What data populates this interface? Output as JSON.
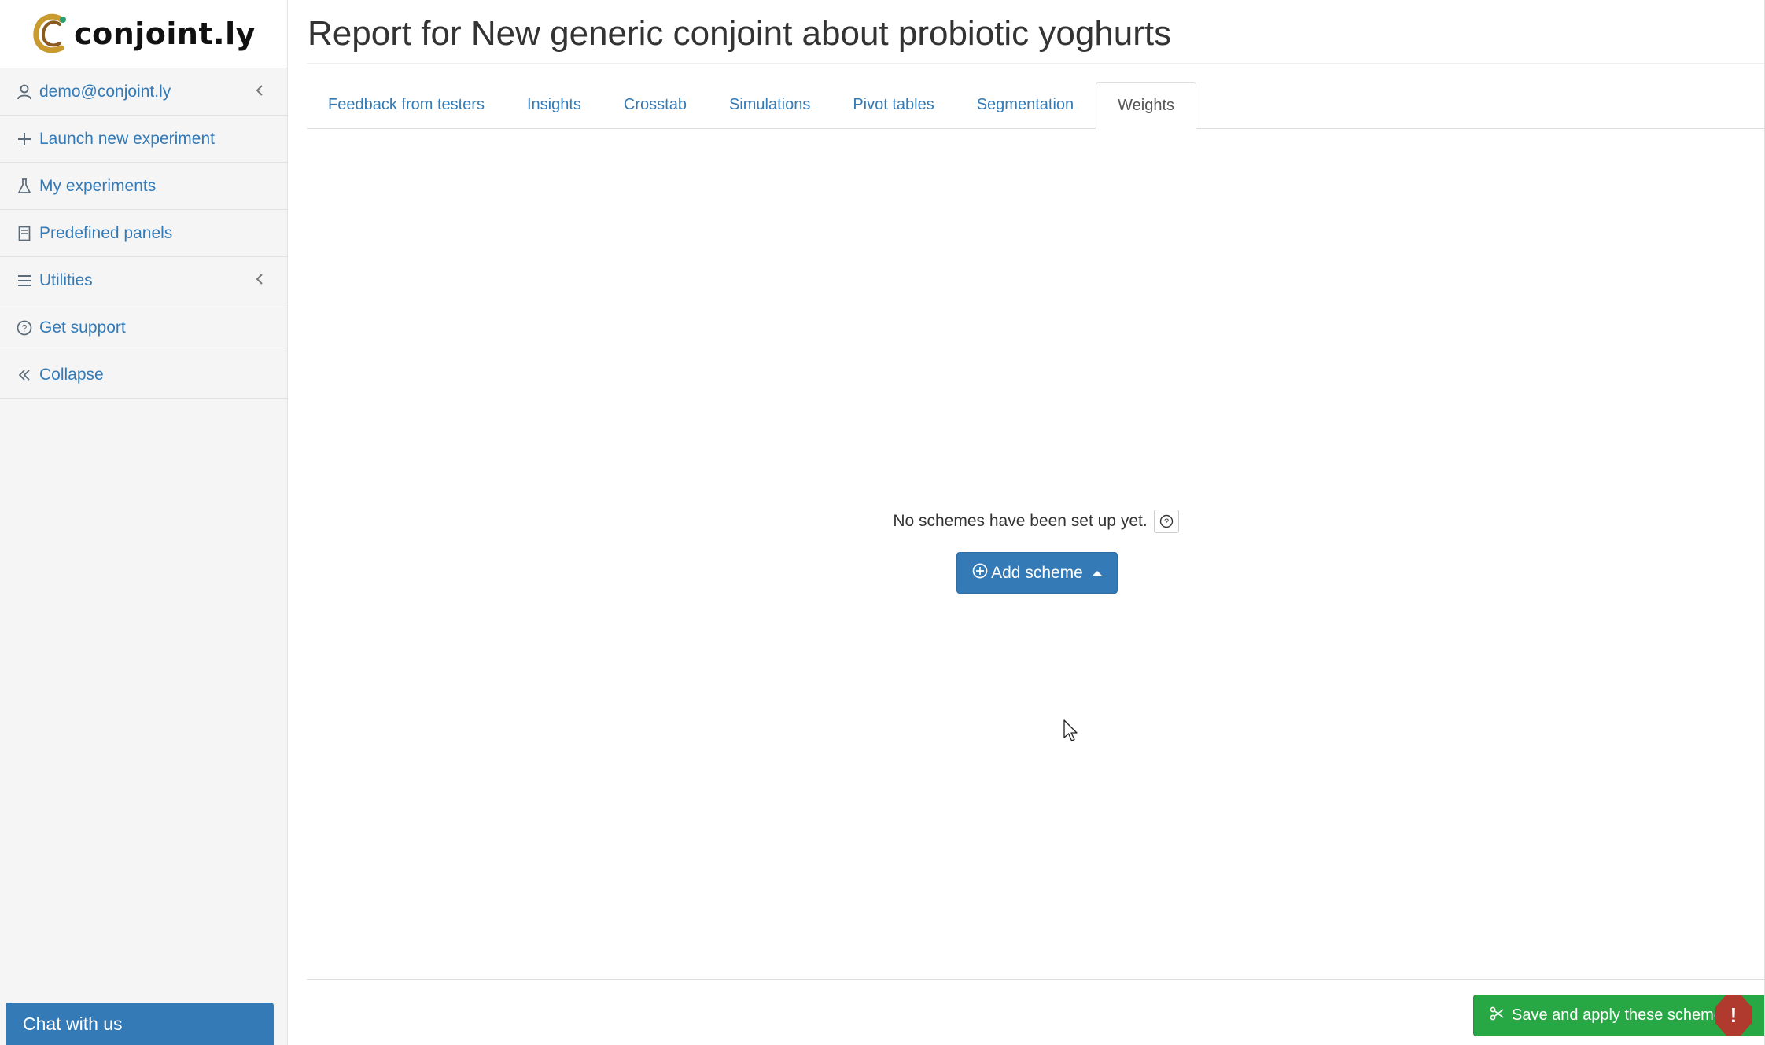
{
  "app": {
    "logo_text": "conjoint.ly"
  },
  "sidebar": {
    "items": [
      {
        "label": "demo@conjoint.ly",
        "icon": "user-icon",
        "has_chevron": true
      },
      {
        "label": "Launch new experiment",
        "icon": "plus-icon"
      },
      {
        "label": "My experiments",
        "icon": "flask-icon"
      },
      {
        "label": "Predefined panels",
        "icon": "book-icon"
      },
      {
        "label": "Utilities",
        "icon": "bars-icon",
        "has_chevron": true
      },
      {
        "label": "Get support",
        "icon": "question-circle-icon"
      },
      {
        "label": "Collapse",
        "icon": "double-chevron-left-icon"
      }
    ],
    "chat_label": "Chat with us"
  },
  "main": {
    "title": "Report for New generic conjoint about probiotic yoghurts",
    "tabs": [
      {
        "label": "Feedback from testers"
      },
      {
        "label": "Insights"
      },
      {
        "label": "Crosstab"
      },
      {
        "label": "Simulations"
      },
      {
        "label": "Pivot tables"
      },
      {
        "label": "Segmentation"
      },
      {
        "label": "Weights",
        "active": true
      }
    ],
    "empty_message": "No schemes have been set up yet.",
    "add_scheme_label": "Add scheme",
    "save_label": "Save and apply these schemes",
    "alert_glyph": "!"
  },
  "colors": {
    "link": "#337ab7",
    "primary": "#337ab7",
    "success": "#28a745",
    "danger": "#b03a2e",
    "sidebar_bg": "#f5f5f5"
  }
}
